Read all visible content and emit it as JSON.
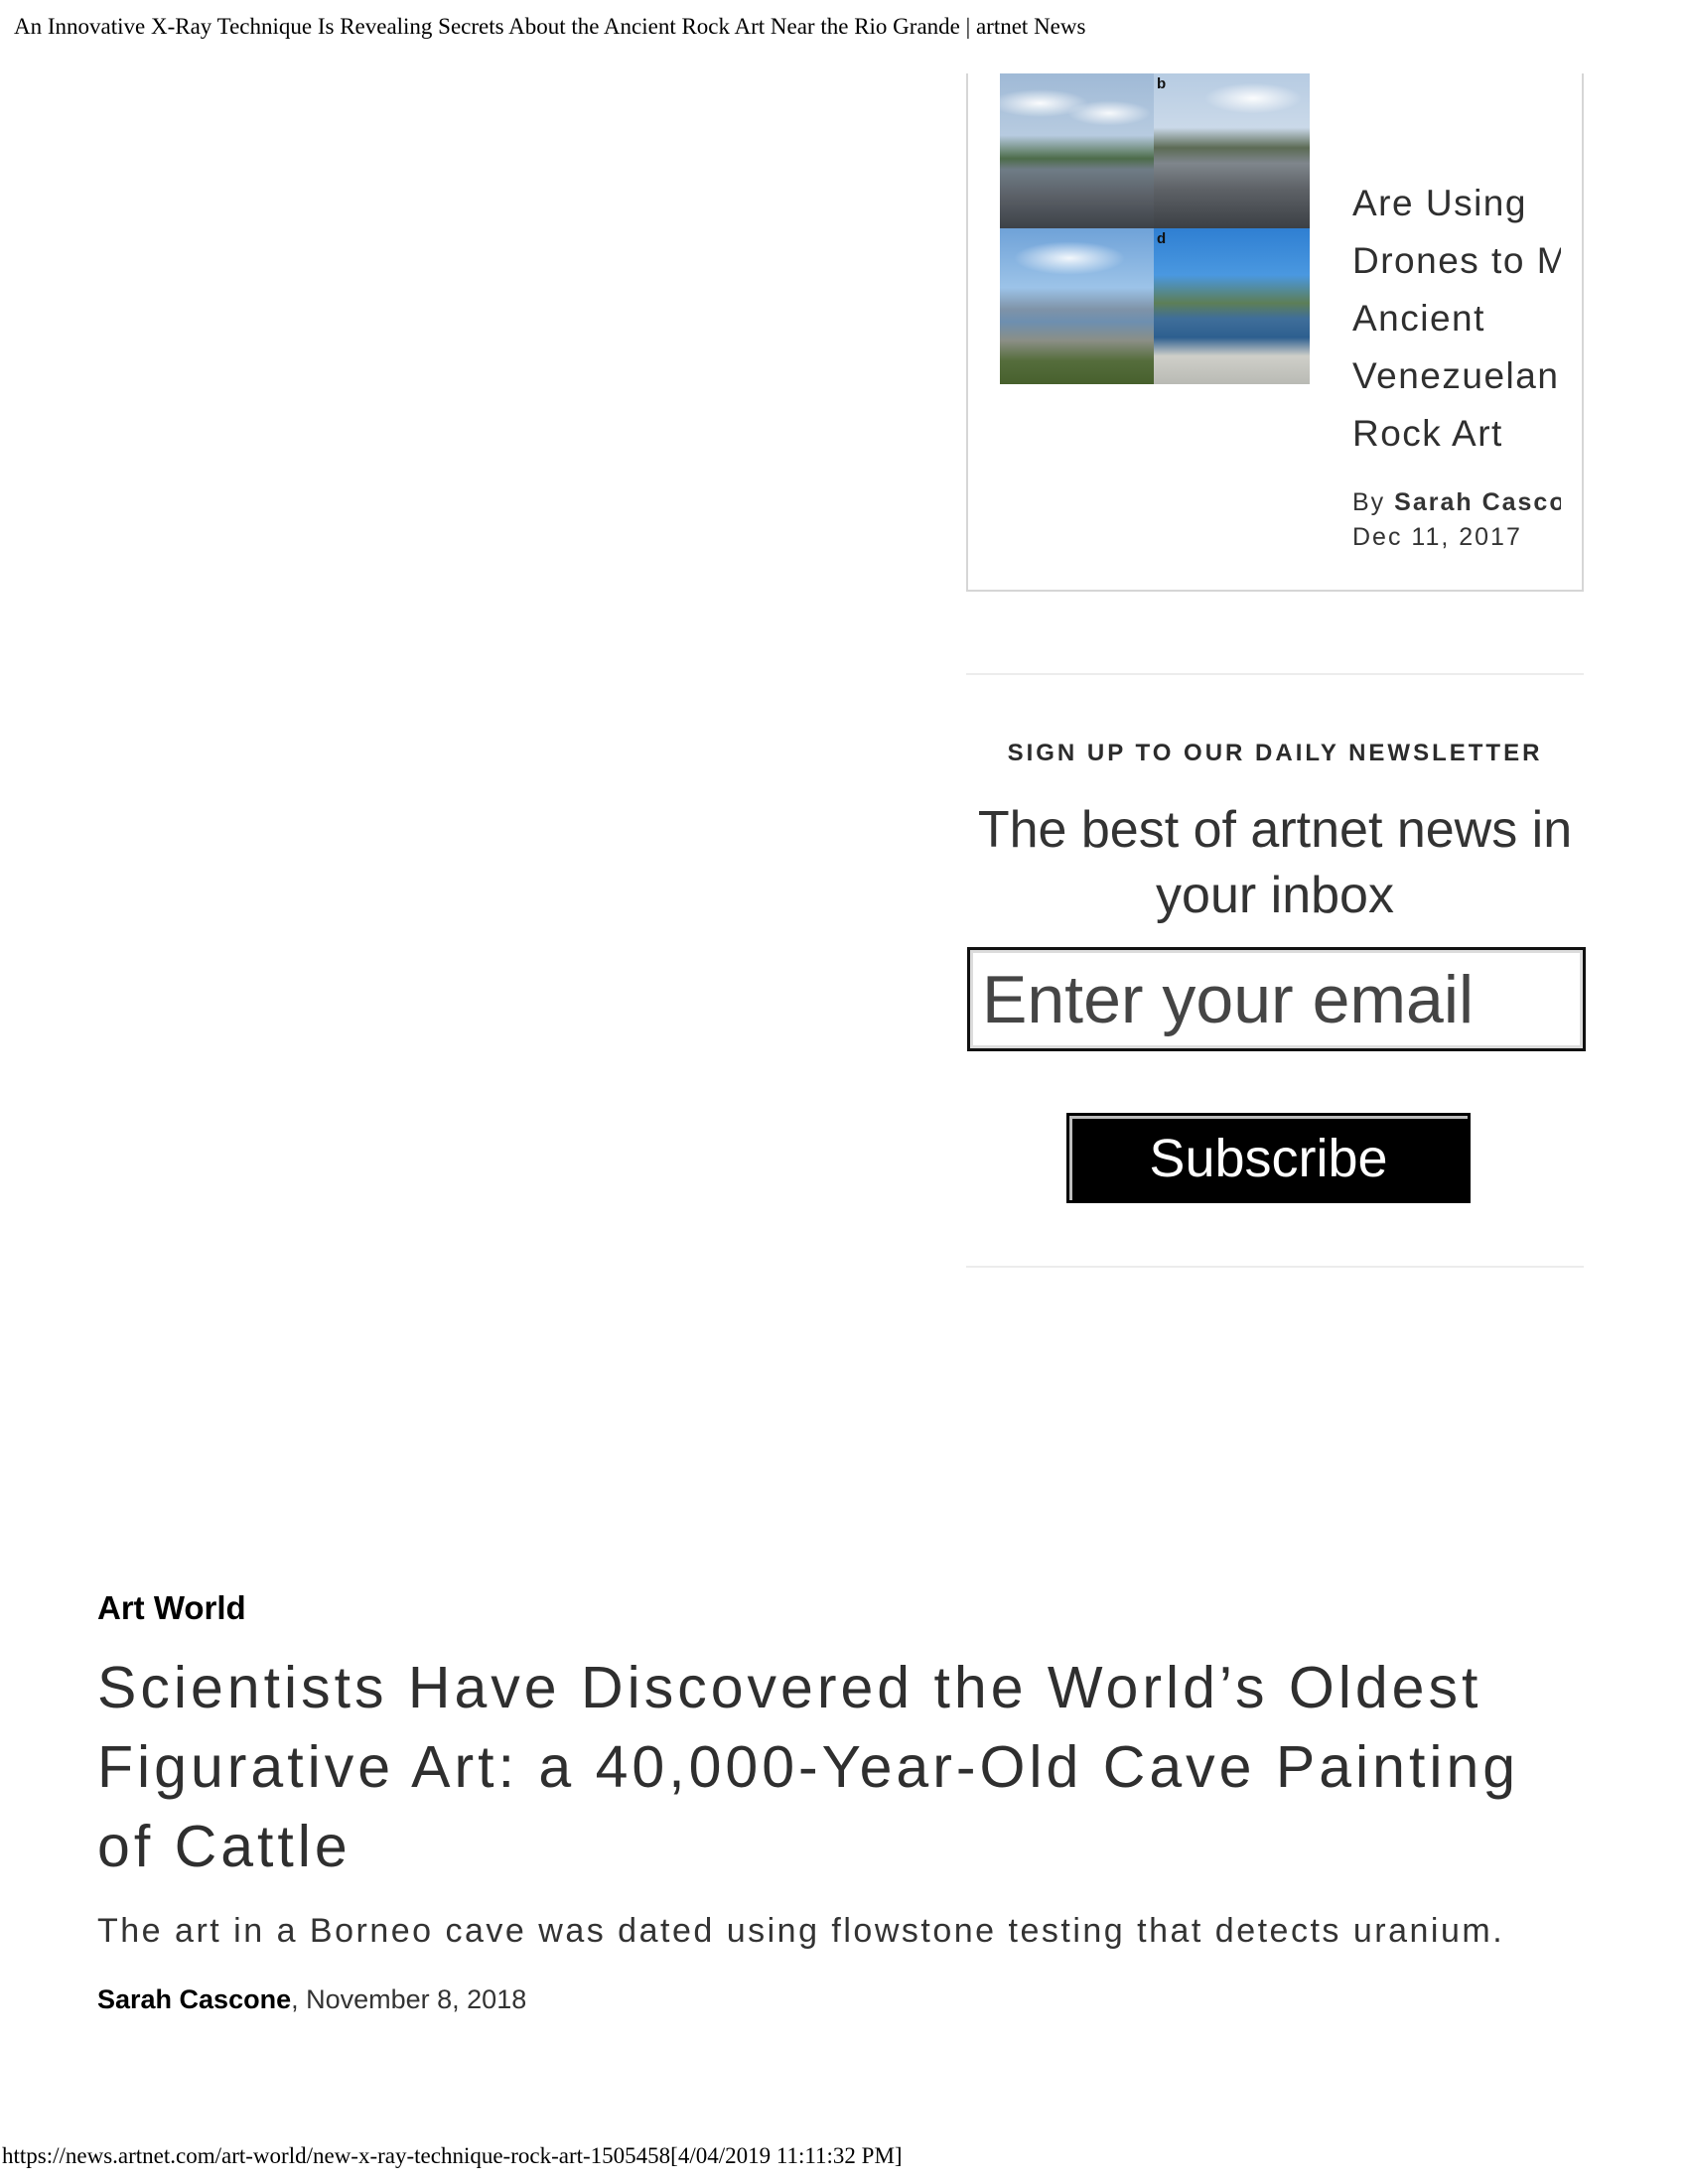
{
  "print_header": {
    "title": "An Innovative X-Ray Technique Is Revealing Secrets About the Ancient Rock Art Near the Rio Grande | artnet News"
  },
  "related_article": {
    "image_labels": [
      "b",
      "d"
    ],
    "title_lines": [
      "Are Using",
      "Drones to M",
      "Ancient",
      "Venezuelan",
      "Rock Art"
    ],
    "byline_prefix": "By",
    "author": "Sarah Cascone",
    "date": "Dec 11, 2017"
  },
  "newsletter": {
    "kicker": "SIGN UP TO OUR DAILY NEWSLETTER",
    "heading": "The best of artnet news in your inbox",
    "email_placeholder": "Enter your email",
    "subscribe_label": "Subscribe"
  },
  "article_teaser": {
    "category": "Art World",
    "headline": "Scientists Have Discovered the World’s Oldest Figurative Art: a 40,000-Year-Old Cave Painting of Cattle",
    "dek": "The art in a Borneo cave was dated using flowstone testing that detects uranium.",
    "author": "Sarah Cascone",
    "date_suffix": ", November 8, 2018"
  },
  "print_footer": {
    "url": "https://news.artnet.com/art-world/new-x-ray-technique-rock-art-1505458[4/04/2019 11:11:32 PM]"
  }
}
